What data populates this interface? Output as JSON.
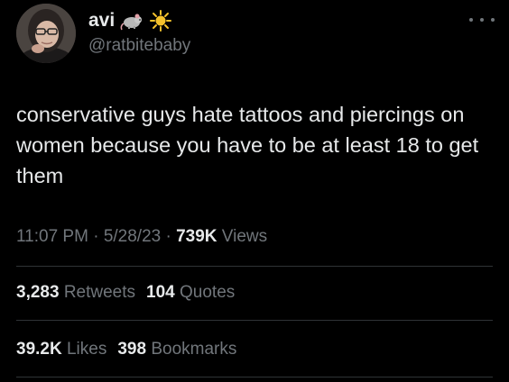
{
  "user": {
    "display_name": "avi",
    "handle": "@ratbitebaby",
    "emojis": [
      "rat-emoji",
      "sun-emoji"
    ]
  },
  "tweet": {
    "text": "conservative guys hate tattoos and piercings on women because you have to be at least 18 to get them"
  },
  "meta": {
    "time": "11:07 PM",
    "separator1": " · ",
    "date": "5/28/23",
    "separator2": " · ",
    "views_count": "739K",
    "views_label": " Views"
  },
  "stats": {
    "retweets_count": "3,283",
    "retweets_label": " Retweets",
    "quotes_count": "104",
    "quotes_label": " Quotes",
    "likes_count": "39.2K",
    "likes_label": " Likes",
    "bookmarks_count": "398",
    "bookmarks_label": " Bookmarks"
  },
  "colors": {
    "background": "#000000",
    "primary_text": "#e7e9ea",
    "secondary_text": "#71767b",
    "divider": "#2f3336"
  }
}
